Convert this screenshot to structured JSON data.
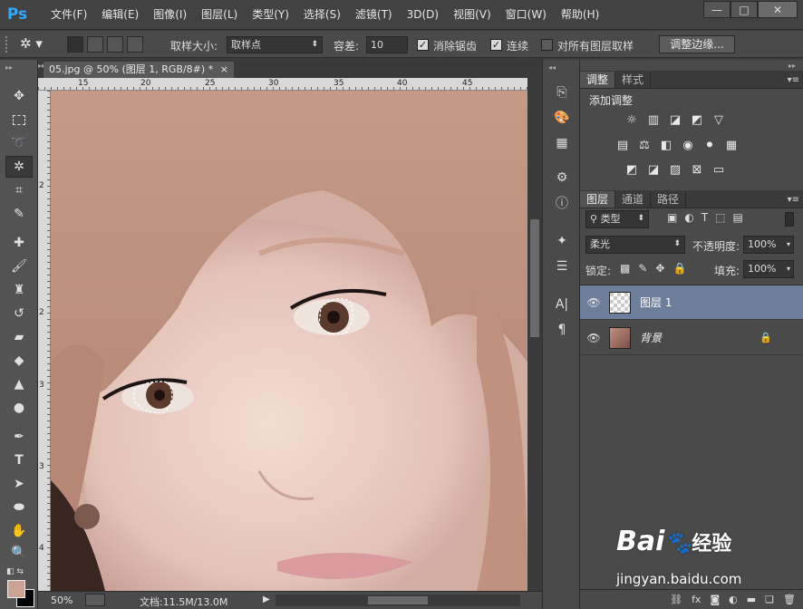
{
  "app": {
    "logo": "Ps"
  },
  "menu": [
    "文件(F)",
    "编辑(E)",
    "图像(I)",
    "图层(L)",
    "类型(Y)",
    "选择(S)",
    "滤镜(T)",
    "3D(D)",
    "视图(V)",
    "窗口(W)",
    "帮助(H)"
  ],
  "window_controls": {
    "minimize": "—",
    "maximize": "□",
    "close": "✕"
  },
  "options": {
    "sample_size_label": "取样大小:",
    "sample_size_value": "取样点",
    "tolerance_label": "容差:",
    "tolerance_value": "10",
    "antialias_label": "消除锯齿",
    "contiguous_label": "连续",
    "all_layers_label": "对所有图层取样",
    "refine_edge_label": "调整边缘..."
  },
  "document": {
    "tab_title": "05.jpg @ 50% (图层 1, RGB/8#) *",
    "tab_close": "×",
    "ruler_marks": [
      "15",
      "20",
      "25",
      "30",
      "35",
      "40",
      "45"
    ],
    "ruler_left_marks": [
      "2",
      "2",
      "3",
      "3",
      "4"
    ]
  },
  "status": {
    "zoom": "50%",
    "doc_info": "文档:11.5M/13.0M"
  },
  "adjustments": {
    "tabs": [
      "调整",
      "样式"
    ],
    "heading": "添加调整"
  },
  "layers": {
    "tabs": [
      "图层",
      "通道",
      "路径"
    ],
    "filter_label": "类型",
    "blend_mode": "柔光",
    "opacity_label": "不透明度:",
    "opacity_value": "100%",
    "lock_label": "锁定:",
    "fill_label": "填充:",
    "fill_value": "100%",
    "items": [
      {
        "name": "图层 1"
      },
      {
        "name": "背景"
      }
    ]
  },
  "watermark": {
    "brand": "Bai",
    "brand2": "经验",
    "url": "jingyan.baidu.com"
  },
  "colors": {
    "selected_layer": "#6c7e9a",
    "accent": "#31a8ff",
    "foreground_swatch": "#c9a393"
  }
}
